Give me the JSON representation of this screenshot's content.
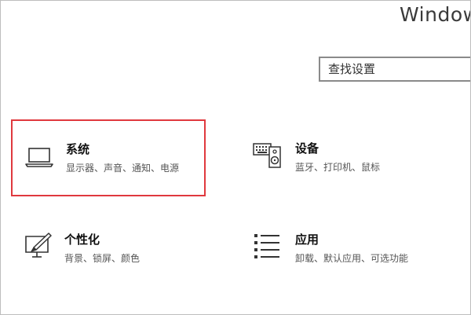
{
  "window": {
    "title": "Window"
  },
  "search": {
    "placeholder": "查找设置"
  },
  "tiles": [
    {
      "title": "系统",
      "subtitle": "显示器、声音、通知、电源",
      "icon": "laptop-icon",
      "selected": true,
      "highlight_color": "#e0393e"
    },
    {
      "title": "设备",
      "subtitle": "蓝牙、打印机、鼠标",
      "icon": "keyboard-speaker-icon"
    },
    {
      "title": "个性化",
      "subtitle": "背景、锁屏、颜色",
      "icon": "paint-screen-icon"
    },
    {
      "title": "应用",
      "subtitle": "卸载、默认应用、可选功能",
      "icon": "apps-list-icon"
    }
  ]
}
